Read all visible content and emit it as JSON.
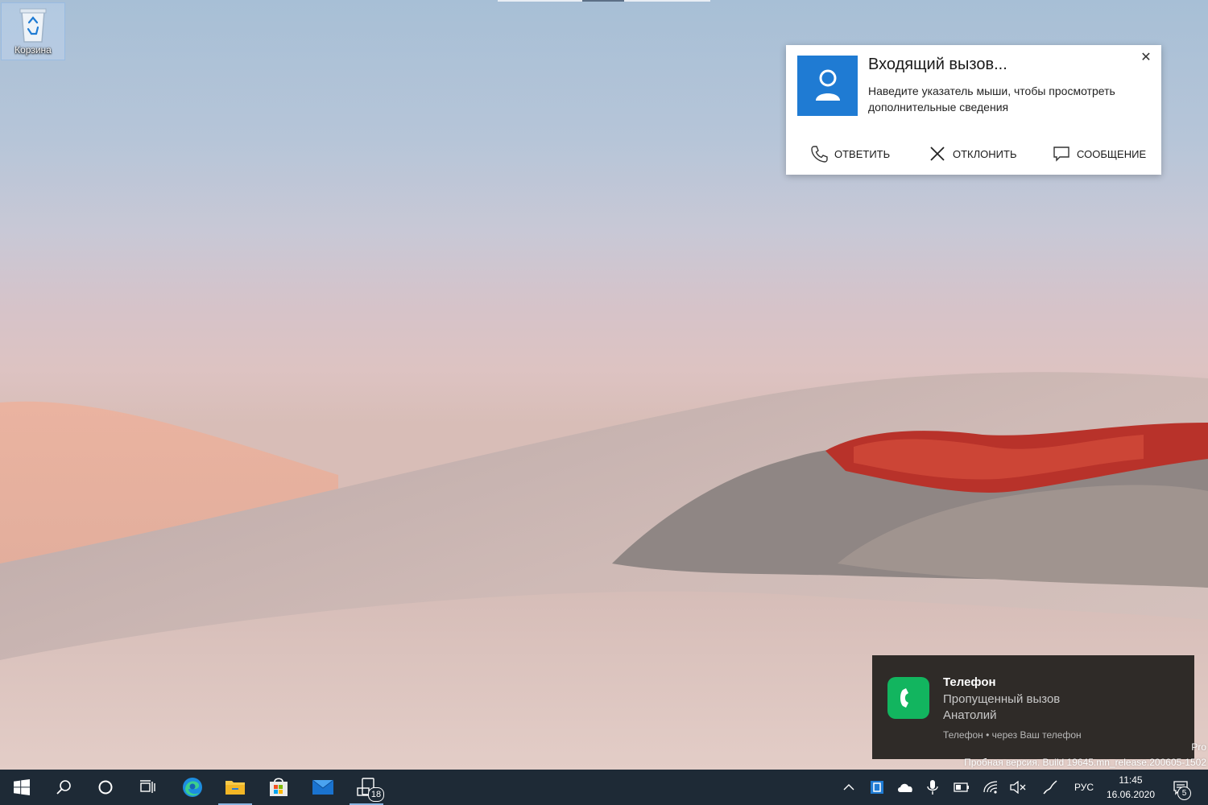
{
  "desktop": {
    "icons": [
      {
        "label": "Корзина",
        "icon": "recycle-bin-icon"
      }
    ]
  },
  "call_toast": {
    "title": "Входящий вызов...",
    "body": "Наведите указатель мыши, чтобы просмотреть дополнительные сведения",
    "close_glyph": "✕",
    "actions": {
      "answer": "ОТВЕТИТЬ",
      "decline": "ОТКЛОНИТЬ",
      "message": "СООБЩЕНИЕ"
    },
    "avatar_color": "#1f7bd3"
  },
  "missed_toast": {
    "app_name": "Телефон",
    "line1": "Пропущенный вызов",
    "line2": "Анатолий",
    "attribution": "Телефон • через Ваш телефон",
    "icon_color": "#12b55f"
  },
  "watermark": {
    "edition": "Pro",
    "build": "Пробная версия. Build 19645.mn_release.200605-1502"
  },
  "taskbar": {
    "pinned": [
      "start-icon",
      "search-icon",
      "cortana-icon",
      "task-view-icon",
      "edge-icon",
      "file-explorer-icon",
      "store-icon",
      "mail-icon",
      "your-phone-icon"
    ],
    "phone_badge": "18",
    "language": "РУС",
    "time": "11:45",
    "date": "16.06.2020",
    "notification_count": "5",
    "accent": "#1e2a36"
  }
}
